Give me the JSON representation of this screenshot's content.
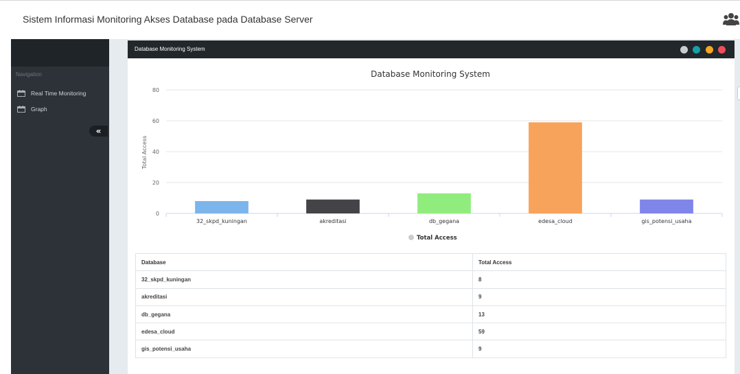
{
  "app_title": "Sistem Informasi Monitoring Akses Database pada Database Server",
  "icons": {
    "header": "users-icon",
    "nav": "calendar-icon",
    "collapse": "double-chevron-left-icon"
  },
  "sidebar": {
    "heading": "Navigation",
    "items": [
      {
        "label": "Real Time Monitoring",
        "icon": "calendar-icon"
      },
      {
        "label": "Graph",
        "icon": "calendar-icon"
      }
    ],
    "collapse_label": "«"
  },
  "panel": {
    "title": "Database Monitoring System",
    "controls": [
      {
        "name": "settings",
        "color": "#c9cdd1"
      },
      {
        "name": "refresh",
        "color": "#16a1a8"
      },
      {
        "name": "minimize",
        "color": "#f5a623"
      },
      {
        "name": "close",
        "color": "#f04e5b"
      }
    ]
  },
  "chart_data": {
    "type": "bar",
    "title": "Database Monitoring System",
    "ylabel": "Total Access",
    "xlabel": "",
    "ylim": [
      0,
      80
    ],
    "yticks": [
      0,
      20,
      40,
      60,
      80
    ],
    "grid": true,
    "legend_position": "bottom",
    "categories": [
      "32_skpd_kuningan",
      "akreditasi",
      "db_gegana",
      "edesa_cloud",
      "gis_potensi_usaha"
    ],
    "series": [
      {
        "name": "Total Access",
        "values": [
          8,
          9,
          13,
          59,
          9
        ]
      }
    ],
    "bar_colors": [
      "#7cb5ec",
      "#434348",
      "#90ed7d",
      "#f7a35c",
      "#8085e9"
    ]
  },
  "table": {
    "headers": [
      "Database",
      "Total Access"
    ],
    "rows": [
      [
        "32_skpd_kuningan",
        "8"
      ],
      [
        "akreditasi",
        "9"
      ],
      [
        "db_gegana",
        "13"
      ],
      [
        "edesa_cloud",
        "59"
      ],
      [
        "gis_potensi_usaha",
        "9"
      ]
    ]
  }
}
